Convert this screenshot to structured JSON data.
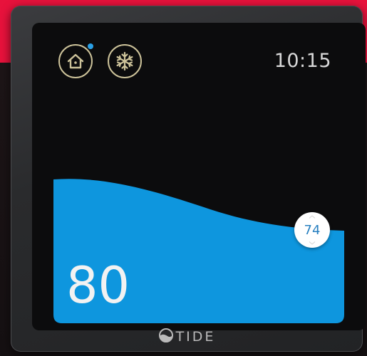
{
  "screen": {
    "time": "10:15",
    "current_temperature": "80",
    "setpoint_temperature": "74"
  },
  "modes": {
    "home_icon": "home-icon",
    "cool_icon": "snowflake-icon",
    "home_indicator_color": "#2aa0e6",
    "icon_color": "#cdc39a"
  },
  "branding": {
    "name": "TIDE",
    "logo_icon": "tide-wave-icon"
  },
  "colors": {
    "water": "#0e96de",
    "accent_background": "#e8123c",
    "setpoint_text": "#2880c0"
  }
}
